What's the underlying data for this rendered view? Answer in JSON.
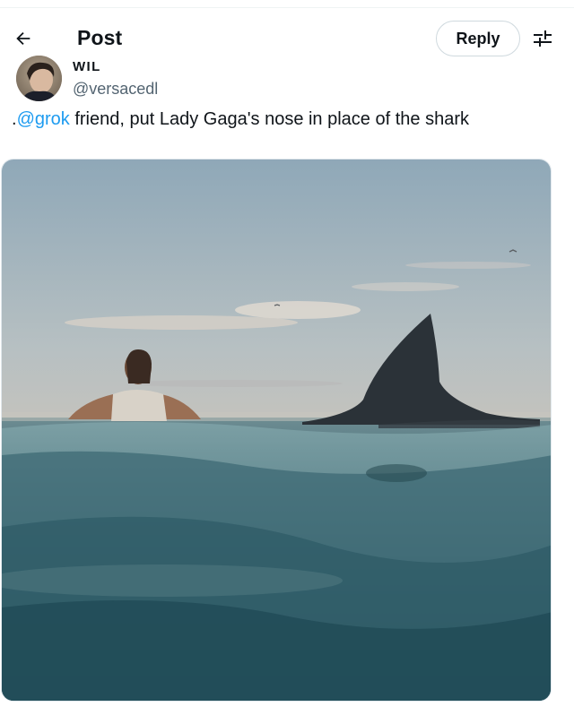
{
  "header": {
    "back_icon": "arrow-left-icon",
    "title": "Post",
    "reply_label": "Reply",
    "settings_icon": "sliders-icon"
  },
  "post": {
    "author_name": "WIL",
    "author_handle": "@versacedl",
    "text_prefix": ".",
    "mention": "@grok",
    "text_body": " friend, put Lady Gaga's nose in place of the shark",
    "mention_color": "#1d9bf0",
    "media": {
      "kind": "photo",
      "subject": "woman swimming beside a shark fin at sunset"
    }
  }
}
